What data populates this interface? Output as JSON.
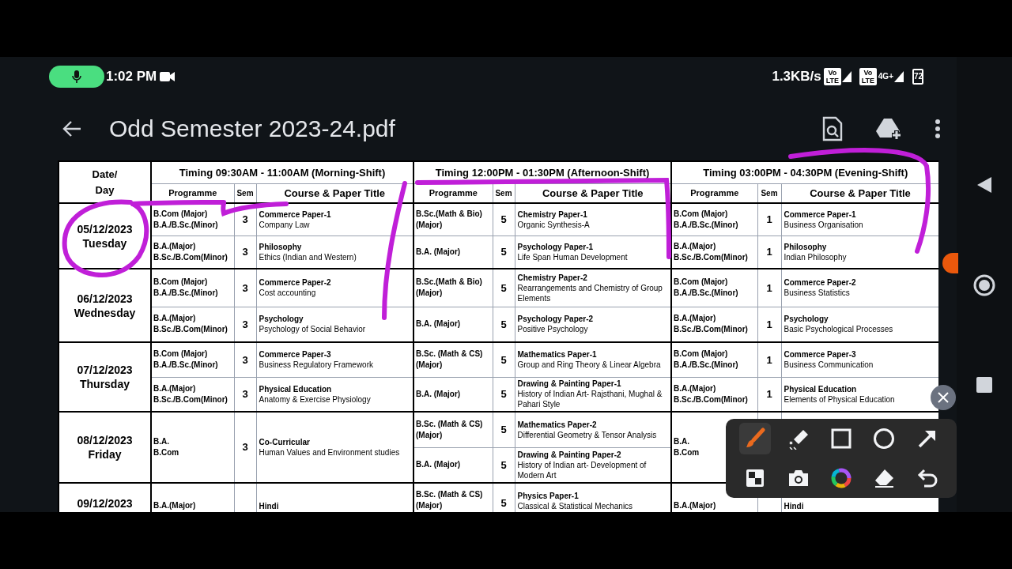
{
  "status_bar": {
    "time": "1:02 PM",
    "network_speed": "1.3KB/s",
    "sim_badges": [
      {
        "badge": "Vo LTE"
      },
      {
        "badge": "Vo LTE",
        "network": "4G+"
      }
    ],
    "battery": "72"
  },
  "app_bar": {
    "title": "Odd Semester 2023-24.pdf"
  },
  "timetable": {
    "date_header": "Date/\nDay",
    "shifts": [
      {
        "timing": "Timing 09:30AM - 11:00AM (Morning-Shift)",
        "columns": [
          "Programme",
          "Sem",
          "Course & Paper Title"
        ]
      },
      {
        "timing": "Timing 12:00PM - 01:30PM (Afternoon-Shift)",
        "columns": [
          "Programme",
          "Sem",
          "Course & Paper Title"
        ]
      },
      {
        "timing": "Timing 03:00PM - 04:30PM (Evening-Shift)",
        "columns": [
          "Programme",
          "Sem",
          "Course & Paper Title"
        ]
      }
    ],
    "days": [
      {
        "date": "05/12/2023",
        "day": "Tuesday",
        "slots": [
          [
            {
              "programme": "B.Com (Major)\nB.A./B.Sc.(Minor)",
              "sem": "3",
              "course": "Commerce  Paper-1",
              "title": "Company Law"
            },
            {
              "programme": "B.A.(Major)\nB.Sc./B.Com(Minor)",
              "sem": "3",
              "course": "Philosophy",
              "title": "Ethics (Indian and Western)"
            }
          ],
          [
            {
              "programme": "B.Sc.(Math & Bio)\n(Major)",
              "sem": "5",
              "course": "Chemistry  Paper-1",
              "title": "Organic Synthesis-A"
            },
            {
              "programme": "B.A. (Major)",
              "sem": "5",
              "course": "Psychology  Paper-1",
              "title": "Life Span Human Development"
            }
          ],
          [
            {
              "programme": "B.Com (Major)\nB.A./B.Sc.(Minor)",
              "sem": "1",
              "course": "Commerce  Paper-1",
              "title": "Business Organisation"
            },
            {
              "programme": "B.A.(Major)\nB.Sc./B.Com(Minor)",
              "sem": "1",
              "course": "Philosophy",
              "title": "Indian Philosophy"
            }
          ]
        ]
      },
      {
        "date": "06/12/2023",
        "day": "Wednesday",
        "slots": [
          [
            {
              "programme": "B.Com (Major)\nB.A./B.Sc.(Minor)",
              "sem": "3",
              "course": "Commerce  Paper-2",
              "title": "Cost accounting"
            },
            {
              "programme": "B.A.(Major)\nB.Sc./B.Com(Minor)",
              "sem": "3",
              "course": "Psychology",
              "title": "Psychology of Social Behavior"
            }
          ],
          [
            {
              "programme": "B.Sc.(Math & Bio)\n(Major)",
              "sem": "5",
              "course": "Chemistry  Paper-2",
              "title": "Rearrangements and Chemistry of Group Elements"
            },
            {
              "programme": "B.A. (Major)",
              "sem": "5",
              "course": "Psychology  Paper-2",
              "title": "Positive Psychology"
            }
          ],
          [
            {
              "programme": "B.Com (Major)\nB.A./B.Sc.(Minor)",
              "sem": "1",
              "course": "Commerce  Paper-2",
              "title": "Business Statistics"
            },
            {
              "programme": "B.A.(Major)\nB.Sc./B.Com(Minor)",
              "sem": "1",
              "course": "Psychology",
              "title": "Basic Psychological Processes"
            }
          ]
        ]
      },
      {
        "date": "07/12/2023",
        "day": "Thursday",
        "slots": [
          [
            {
              "programme": "B.Com (Major)\nB.A./B.Sc.(Minor)",
              "sem": "3",
              "course": "Commerce  Paper-3",
              "title": "Business Regulatory Framework"
            },
            {
              "programme": "B.A.(Major)\nB.Sc./B.Com(Minor)",
              "sem": "3",
              "course": "Physical Education",
              "title": "Anatomy & Exercise Physiology"
            }
          ],
          [
            {
              "programme": "B.Sc. (Math & CS)\n(Major)",
              "sem": "5",
              "course": "Mathematics  Paper-1",
              "title": "Group and Ring Theory & Linear Algebra"
            },
            {
              "programme": "B.A. (Major)",
              "sem": "5",
              "course": "Drawing & Painting  Paper-1",
              "title": "History of Indian Art- Rajsthani, Mughal & Pahari Style"
            }
          ],
          [
            {
              "programme": "B.Com (Major)\nB.A./B.Sc.(Minor)",
              "sem": "1",
              "course": "Commerce  Paper-3",
              "title": "Business Communication"
            },
            {
              "programme": "B.A.(Major)\nB.Sc./B.Com(Minor)",
              "sem": "1",
              "course": "Physical Education",
              "title": "Elements of Physical Education"
            }
          ]
        ]
      },
      {
        "date": "08/12/2023",
        "day": "Friday",
        "slots": [
          [
            {
              "programme": "B.A.\nB.Com",
              "sem": "3",
              "course": "Co-Curricular",
              "title": "Human Values and Environment studies"
            }
          ],
          [
            {
              "programme": "B.Sc. (Math & CS)\n(Major)",
              "sem": "5",
              "course": "Mathematics  Paper-2",
              "title": "Differential Geometry & Tensor Analysis"
            },
            {
              "programme": "B.A. (Major)",
              "sem": "5",
              "course": "Drawing & Painting  Paper-2",
              "title": "History of Indian art- Development of Modern Art"
            }
          ],
          [
            {
              "programme": "B.A.\nB.Com"
            }
          ]
        ]
      },
      {
        "date": "09/12/2023",
        "slots": [
          [
            {
              "programme": "B.A.(Major)",
              "course": "Hindi"
            }
          ],
          [
            {
              "programme": "B.Sc. (Math & CS)\n(Major)",
              "sem": "5",
              "course": "Physics  Paper-1",
              "title": "Classical & Statistical Mechanics"
            }
          ],
          [
            {
              "programme": "B.A.(Major)",
              "course": "Hindi"
            }
          ]
        ]
      }
    ]
  },
  "annotation_toolbar": {
    "tools": [
      {
        "kind": "brush",
        "selected": true
      },
      {
        "kind": "highlighter",
        "selected": false
      },
      {
        "kind": "rectangle",
        "selected": false
      },
      {
        "kind": "circle",
        "selected": false
      },
      {
        "kind": "arrow",
        "selected": false
      },
      {
        "kind": "mosaic",
        "selected": false
      },
      {
        "kind": "camera",
        "selected": false
      },
      {
        "kind": "color",
        "selected": false
      },
      {
        "kind": "eraser",
        "selected": false
      },
      {
        "kind": "undo",
        "selected": false
      }
    ]
  }
}
